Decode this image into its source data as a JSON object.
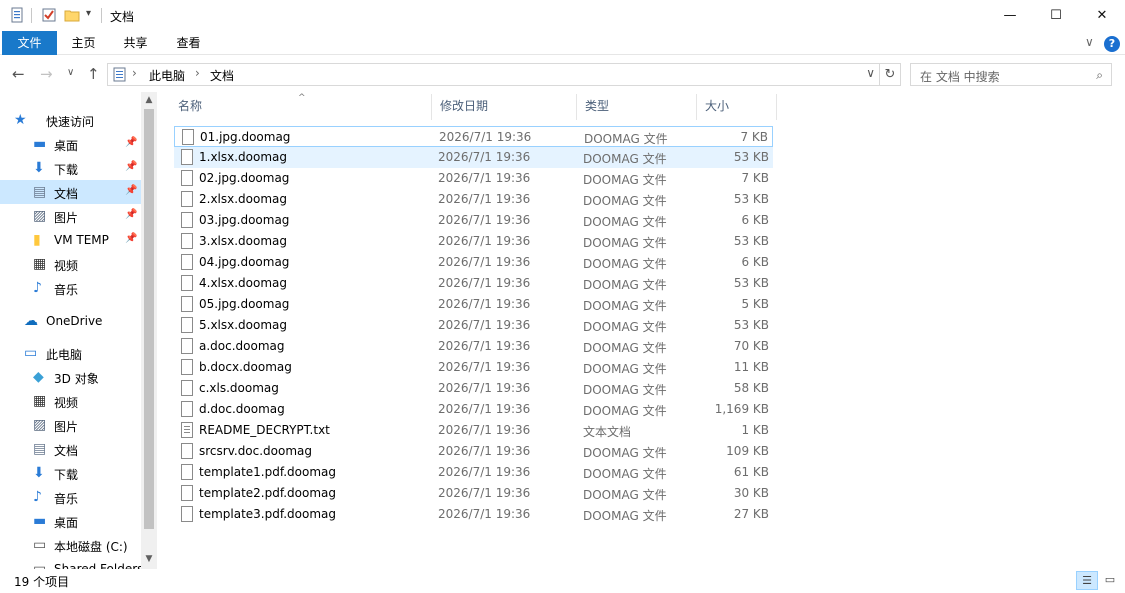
{
  "window": {
    "title": "文档",
    "minimize_glyph": "—",
    "maximize_glyph": "☐",
    "close_glyph": "✕"
  },
  "ribbon": {
    "tabs": [
      "文件",
      "主页",
      "共享",
      "查看"
    ],
    "collapse_glyph": "∨",
    "help_glyph": "?"
  },
  "address": {
    "back_glyph": "←",
    "forward_glyph": "→",
    "recent_glyph": "∨",
    "up_glyph": "↑",
    "crumbs": [
      "此电脑",
      "文档"
    ],
    "crumb_sep": "›",
    "dropdown_glyph": "∨",
    "refresh_glyph": "↻"
  },
  "search": {
    "placeholder": "在 文档 中搜索",
    "icon_glyph": "⌕"
  },
  "nav": {
    "pin_glyph": "📌",
    "items": [
      {
        "label": "快速访问",
        "icon": "quick-access-icon",
        "pinned": false,
        "selected": false
      },
      {
        "label": "桌面",
        "icon": "desktop-icon",
        "pinned": true,
        "selected": false
      },
      {
        "label": "下载",
        "icon": "download-icon",
        "pinned": true,
        "selected": false
      },
      {
        "label": "文档",
        "icon": "documents-icon",
        "pinned": true,
        "selected": true
      },
      {
        "label": "图片",
        "icon": "pictures-icon",
        "pinned": true,
        "selected": false
      },
      {
        "label": "VM TEMP",
        "icon": "folder-icon",
        "pinned": true,
        "selected": false
      },
      {
        "label": "视频",
        "icon": "videos-icon",
        "pinned": false,
        "selected": false
      },
      {
        "label": "音乐",
        "icon": "music-icon",
        "pinned": false,
        "selected": false
      },
      {
        "label": "OneDrive",
        "icon": "onedrive-icon",
        "pinned": false,
        "selected": false
      },
      {
        "label": "此电脑",
        "icon": "this-pc-icon",
        "pinned": false,
        "selected": false
      },
      {
        "label": "3D 对象",
        "icon": "3d-objects-icon",
        "pinned": false,
        "selected": false
      },
      {
        "label": "视频",
        "icon": "videos-icon",
        "pinned": false,
        "selected": false
      },
      {
        "label": "图片",
        "icon": "pictures-icon",
        "pinned": false,
        "selected": false
      },
      {
        "label": "文档",
        "icon": "documents-icon",
        "pinned": false,
        "selected": false
      },
      {
        "label": "下载",
        "icon": "download-icon",
        "pinned": false,
        "selected": false
      },
      {
        "label": "音乐",
        "icon": "music-icon",
        "pinned": false,
        "selected": false
      },
      {
        "label": "桌面",
        "icon": "desktop-icon",
        "pinned": false,
        "selected": false
      },
      {
        "label": "本地磁盘 (C:)",
        "icon": "drive-icon",
        "pinned": false,
        "selected": false
      },
      {
        "label": "Shared Folders",
        "icon": "network-drive-icon",
        "pinned": false,
        "selected": false
      }
    ]
  },
  "columns": {
    "name": "名称",
    "date": "修改日期",
    "type": "类型",
    "size": "大小"
  },
  "files": [
    {
      "name": "01.jpg.doomag",
      "date": "2026/7/1 19:36",
      "type": "DOOMAG 文件",
      "size": "7 KB"
    },
    {
      "name": "1.xlsx.doomag",
      "date": "2026/7/1 19:36",
      "type": "DOOMAG 文件",
      "size": "53 KB"
    },
    {
      "name": "02.jpg.doomag",
      "date": "2026/7/1 19:36",
      "type": "DOOMAG 文件",
      "size": "7 KB"
    },
    {
      "name": "2.xlsx.doomag",
      "date": "2026/7/1 19:36",
      "type": "DOOMAG 文件",
      "size": "53 KB"
    },
    {
      "name": "03.jpg.doomag",
      "date": "2026/7/1 19:36",
      "type": "DOOMAG 文件",
      "size": "6 KB"
    },
    {
      "name": "3.xlsx.doomag",
      "date": "2026/7/1 19:36",
      "type": "DOOMAG 文件",
      "size": "53 KB"
    },
    {
      "name": "04.jpg.doomag",
      "date": "2026/7/1 19:36",
      "type": "DOOMAG 文件",
      "size": "6 KB"
    },
    {
      "name": "4.xlsx.doomag",
      "date": "2026/7/1 19:36",
      "type": "DOOMAG 文件",
      "size": "53 KB"
    },
    {
      "name": "05.jpg.doomag",
      "date": "2026/7/1 19:36",
      "type": "DOOMAG 文件",
      "size": "5 KB"
    },
    {
      "name": "5.xlsx.doomag",
      "date": "2026/7/1 19:36",
      "type": "DOOMAG 文件",
      "size": "53 KB"
    },
    {
      "name": "a.doc.doomag",
      "date": "2026/7/1 19:36",
      "type": "DOOMAG 文件",
      "size": "70 KB"
    },
    {
      "name": "b.docx.doomag",
      "date": "2026/7/1 19:36",
      "type": "DOOMAG 文件",
      "size": "11 KB"
    },
    {
      "name": "c.xls.doomag",
      "date": "2026/7/1 19:36",
      "type": "DOOMAG 文件",
      "size": "58 KB"
    },
    {
      "name": "d.doc.doomag",
      "date": "2026/7/1 19:36",
      "type": "DOOMAG 文件",
      "size": "1,169 KB"
    },
    {
      "name": "README_DECRYPT.txt",
      "date": "2026/7/1 19:36",
      "type": "文本文档",
      "size": "1 KB"
    },
    {
      "name": "srcsrv.doc.doomag",
      "date": "2026/7/1 19:36",
      "type": "DOOMAG 文件",
      "size": "109 KB"
    },
    {
      "name": "template1.pdf.doomag",
      "date": "2026/7/1 19:36",
      "type": "DOOMAG 文件",
      "size": "61 KB"
    },
    {
      "name": "template2.pdf.doomag",
      "date": "2026/7/1 19:36",
      "type": "DOOMAG 文件",
      "size": "30 KB"
    },
    {
      "name": "template3.pdf.doomag",
      "date": "2026/7/1 19:36",
      "type": "DOOMAG 文件",
      "size": "27 KB"
    }
  ],
  "status": {
    "item_count": "19 个项目"
  },
  "colors": {
    "accent": "#1979ca",
    "selection": "#cce8ff",
    "hover": "#e5f3ff"
  }
}
